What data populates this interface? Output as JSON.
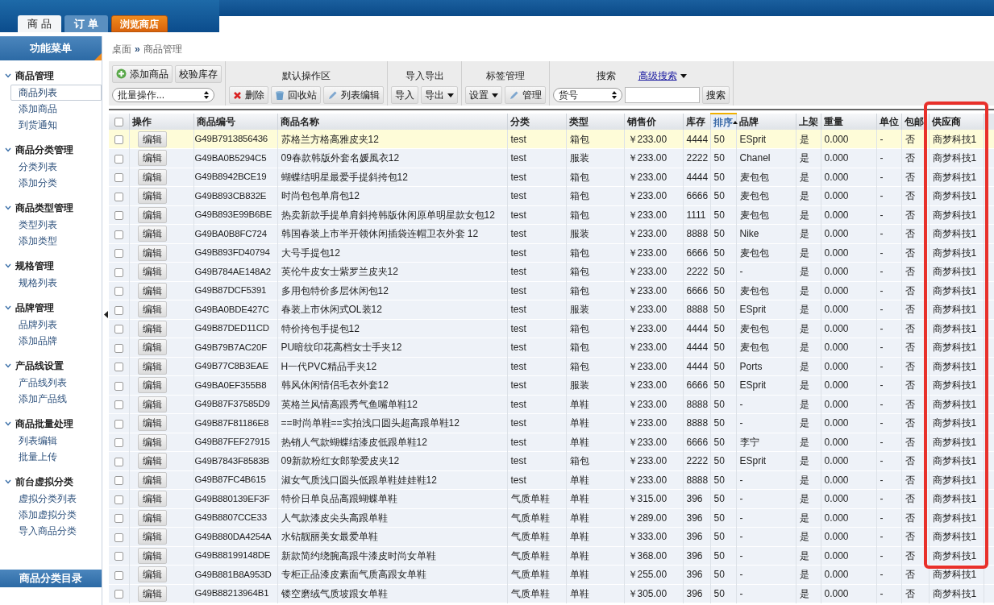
{
  "top_tabs": [
    {
      "label": "商 品",
      "selected": true
    },
    {
      "label": "订 单",
      "selected": false
    }
  ],
  "shop_button": {
    "label": "浏览商店"
  },
  "sidebar": {
    "title": "功能菜单",
    "groups": [
      {
        "title": "商品管理",
        "expanded": true,
        "items": [
          {
            "label": "商品列表",
            "selected": true
          },
          {
            "label": "添加商品",
            "selected": false
          },
          {
            "label": "到货通知",
            "selected": false
          }
        ]
      },
      {
        "title": "商品分类管理",
        "expanded": true,
        "items": [
          {
            "label": "分类列表",
            "selected": false
          },
          {
            "label": "添加分类",
            "selected": false
          }
        ]
      },
      {
        "title": "商品类型管理",
        "expanded": true,
        "items": [
          {
            "label": "类型列表",
            "selected": false
          },
          {
            "label": "添加类型",
            "selected": false
          }
        ]
      },
      {
        "title": "规格管理",
        "expanded": true,
        "items": [
          {
            "label": "规格列表",
            "selected": false
          }
        ]
      },
      {
        "title": "品牌管理",
        "expanded": true,
        "items": [
          {
            "label": "品牌列表",
            "selected": false
          },
          {
            "label": "添加品牌",
            "selected": false
          }
        ]
      },
      {
        "title": "产品线设置",
        "expanded": true,
        "items": [
          {
            "label": "产品线列表",
            "selected": false
          },
          {
            "label": "添加产品线",
            "selected": false
          }
        ]
      },
      {
        "title": "商品批量处理",
        "expanded": true,
        "items": [
          {
            "label": "列表编辑",
            "selected": false
          },
          {
            "label": "批量上传",
            "selected": false
          }
        ]
      },
      {
        "title": "前台虚拟分类",
        "expanded": true,
        "items": [
          {
            "label": "虚拟分类列表",
            "selected": false
          },
          {
            "label": "添加虚拟分类",
            "selected": false
          },
          {
            "label": "导入商品分类",
            "selected": false
          }
        ]
      }
    ],
    "footer": "商品分类目录"
  },
  "breadcrumb": [
    "桌面",
    "»",
    "商品管理"
  ],
  "toolbar": [
    {
      "rows": [
        [
          {
            "kind": "add",
            "label": "添加商品"
          },
          {
            "kind": "button",
            "label": "校验库存"
          }
        ],
        [
          {
            "kind": "select",
            "label": "批量操作..."
          }
        ]
      ]
    },
    {
      "title": "默认操作区",
      "rows": [
        [
          {
            "kind": "delete",
            "label": "删除"
          },
          {
            "kind": "trash",
            "label": "回收站"
          },
          {
            "kind": "edit",
            "label": "列表编辑"
          }
        ]
      ]
    },
    {
      "title": "导入导出",
      "rows": [
        [
          {
            "kind": "button",
            "label": "导入"
          },
          {
            "kind": "dropdown",
            "label": "导出"
          }
        ]
      ]
    },
    {
      "title": "标签管理",
      "rows": [
        [
          {
            "kind": "dropdown",
            "label": "设置"
          },
          {
            "kind": "edit",
            "label": "管理"
          }
        ]
      ]
    },
    {
      "title": "搜索",
      "link": "高级搜索",
      "rows": [
        [
          {
            "kind": "select",
            "label": "货号"
          },
          {
            "kind": "input"
          },
          {
            "kind": "button",
            "label": "搜索"
          }
        ]
      ]
    }
  ],
  "table": {
    "select_all": {
      "checked": false
    },
    "columns": [
      {
        "label": "操作",
        "sorted": false,
        "highlighted": false
      },
      {
        "label": "商品编号",
        "sorted": false,
        "highlighted": false
      },
      {
        "label": "商品名称",
        "sorted": false,
        "highlighted": false
      },
      {
        "label": "分类",
        "sorted": false,
        "highlighted": false
      },
      {
        "label": "类型",
        "sorted": false,
        "highlighted": false
      },
      {
        "label": "销售价",
        "sorted": false,
        "highlighted": false
      },
      {
        "label": "库存",
        "sorted": false,
        "highlighted": false
      },
      {
        "label": "排序",
        "sorted": true,
        "highlighted": false
      },
      {
        "label": "品牌",
        "sorted": false,
        "highlighted": false
      },
      {
        "label": "上架",
        "sorted": false,
        "highlighted": false
      },
      {
        "label": "重量",
        "sorted": false,
        "highlighted": false
      },
      {
        "label": "单位",
        "sorted": false,
        "highlighted": false
      },
      {
        "label": "包邮",
        "sorted": false,
        "highlighted": false
      },
      {
        "label": "供应商",
        "sorted": false,
        "highlighted": true
      }
    ],
    "rows": [
      {
        "selected": true,
        "checked": false,
        "cells": [
          "编辑",
          "G49B7913856436",
          "苏格兰方格高雅皮夹12",
          "test",
          "箱包",
          "￥233.00",
          "4444",
          "50",
          "ESprit",
          "是",
          "0.000",
          "-",
          "否",
          "商梦科技1"
        ]
      },
      {
        "selected": false,
        "checked": false,
        "cells": [
          "编辑",
          "G49BA0B5294C5",
          "09春款韩版外套名媛風衣12",
          "test",
          "服装",
          "￥233.00",
          "2222",
          "50",
          "Chanel",
          "是",
          "0.000",
          "-",
          "否",
          "商梦科技1"
        ]
      },
      {
        "selected": false,
        "checked": false,
        "cells": [
          "编辑",
          "G49B8942BCE19",
          "蝴蝶结明星最爱手提斜挎包12",
          "test",
          "箱包",
          "￥233.00",
          "4444",
          "50",
          "麦包包",
          "是",
          "0.000",
          "-",
          "否",
          "商梦科技1"
        ]
      },
      {
        "selected": false,
        "checked": false,
        "cells": [
          "编辑",
          "G49B893CB832E",
          "时尚包包单肩包12",
          "test",
          "箱包",
          "￥233.00",
          "6666",
          "50",
          "麦包包",
          "是",
          "0.000",
          "-",
          "否",
          "商梦科技1"
        ]
      },
      {
        "selected": false,
        "checked": false,
        "cells": [
          "编辑",
          "G49B893E99B6BE",
          "热卖新款手提单肩斜挎韩版休闲原单明星款女包12",
          "test",
          "箱包",
          "￥233.00",
          "1111",
          "50",
          "麦包包",
          "是",
          "0.000",
          "-",
          "否",
          "商梦科技1"
        ]
      },
      {
        "selected": false,
        "checked": false,
        "cells": [
          "编辑",
          "G49BA0B8FC724",
          "韩国春装上市半开领休闲插袋连帽卫衣外套 12",
          "test",
          "服装",
          "￥233.00",
          "8888",
          "50",
          "Nike",
          "是",
          "0.000",
          "-",
          "否",
          "商梦科技1"
        ]
      },
      {
        "selected": false,
        "checked": false,
        "cells": [
          "编辑",
          "G49B893FD40794",
          "大号手提包12",
          "test",
          "箱包",
          "￥233.00",
          "6666",
          "50",
          "麦包包",
          "是",
          "0.000",
          "-",
          "否",
          "商梦科技1"
        ]
      },
      {
        "selected": false,
        "checked": false,
        "cells": [
          "编辑",
          "G49B784AE148A2",
          "英伦牛皮女士紫罗兰皮夹12",
          "test",
          "箱包",
          "￥233.00",
          "2222",
          "50",
          "-",
          "是",
          "0.000",
          "-",
          "否",
          "商梦科技1"
        ]
      },
      {
        "selected": false,
        "checked": false,
        "cells": [
          "编辑",
          "G49B87DCF5391",
          "多用包特价多层休闲包12",
          "test",
          "箱包",
          "￥233.00",
          "6666",
          "50",
          "麦包包",
          "是",
          "0.000",
          "-",
          "否",
          "商梦科技1"
        ]
      },
      {
        "selected": false,
        "checked": false,
        "cells": [
          "编辑",
          "G49BA0BDE427C",
          "春装上市休闲式OL装12",
          "test",
          "服装",
          "￥233.00",
          "8888",
          "50",
          "ESprit",
          "是",
          "0.000",
          "-",
          "否",
          "商梦科技1"
        ]
      },
      {
        "selected": false,
        "checked": false,
        "cells": [
          "编辑",
          "G49B87DED11CD",
          "特价挎包手提包12",
          "test",
          "箱包",
          "￥233.00",
          "4444",
          "50",
          "麦包包",
          "是",
          "0.000",
          "-",
          "否",
          "商梦科技1"
        ]
      },
      {
        "selected": false,
        "checked": false,
        "cells": [
          "编辑",
          "G49B79B7AC20F",
          "PU暗纹印花高档女士手夹12",
          "test",
          "箱包",
          "￥233.00",
          "4444",
          "50",
          "麦包包",
          "是",
          "0.000",
          "-",
          "否",
          "商梦科技1"
        ]
      },
      {
        "selected": false,
        "checked": false,
        "cells": [
          "编辑",
          "G49B77C8B3EAE",
          "H一代PVC精品手夹12",
          "test",
          "箱包",
          "￥233.00",
          "4444",
          "50",
          "Ports",
          "是",
          "0.000",
          "-",
          "否",
          "商梦科技1"
        ]
      },
      {
        "selected": false,
        "checked": false,
        "cells": [
          "编辑",
          "G49BA0EF355B8",
          "韩风休闲情侣毛衣外套12",
          "test",
          "服装",
          "￥233.00",
          "6666",
          "50",
          "ESprit",
          "是",
          "0.000",
          "-",
          "否",
          "商梦科技1"
        ]
      },
      {
        "selected": false,
        "checked": false,
        "cells": [
          "编辑",
          "G49B87F37585D9",
          "英格兰风情高跟秀气鱼嘴单鞋12",
          "test",
          "单鞋",
          "￥233.00",
          "8888",
          "50",
          "-",
          "是",
          "0.000",
          "-",
          "否",
          "商梦科技1"
        ]
      },
      {
        "selected": false,
        "checked": false,
        "cells": [
          "编辑",
          "G49B87F81186E8",
          "==时尚单鞋==实拍浅口圆头超高跟单鞋12",
          "test",
          "单鞋",
          "￥233.00",
          "8888",
          "50",
          "-",
          "是",
          "0.000",
          "-",
          "否",
          "商梦科技1"
        ]
      },
      {
        "selected": false,
        "checked": false,
        "cells": [
          "编辑",
          "G49B87FEF27915",
          "热销人气款蝴蝶结漆皮低跟单鞋12",
          "test",
          "单鞋",
          "￥233.00",
          "6666",
          "50",
          "李宁",
          "是",
          "0.000",
          "-",
          "否",
          "商梦科技1"
        ]
      },
      {
        "selected": false,
        "checked": false,
        "cells": [
          "编辑",
          "G49B7843F8583B",
          "09新款粉红女郎挚爱皮夹12",
          "test",
          "箱包",
          "￥233.00",
          "2222",
          "50",
          "ESprit",
          "是",
          "0.000",
          "-",
          "否",
          "商梦科技1"
        ]
      },
      {
        "selected": false,
        "checked": false,
        "cells": [
          "编辑",
          "G49B87FC4B615",
          "淑女气质浅口圆头低跟单鞋娃娃鞋12",
          "test",
          "单鞋",
          "￥233.00",
          "8888",
          "50",
          "-",
          "是",
          "0.000",
          "-",
          "否",
          "商梦科技1"
        ]
      },
      {
        "selected": false,
        "checked": false,
        "cells": [
          "编辑",
          "G49B880139EF3F",
          "特价日单良品高跟蝴蝶单鞋",
          "气质单鞋",
          "单鞋",
          "￥315.00",
          "396",
          "50",
          "-",
          "是",
          "0.000",
          "-",
          "否",
          "商梦科技1"
        ]
      },
      {
        "selected": false,
        "checked": false,
        "cells": [
          "编辑",
          "G49B8807CCE33",
          "人气款漆皮尖头高跟单鞋",
          "气质单鞋",
          "单鞋",
          "￥289.00",
          "396",
          "50",
          "-",
          "是",
          "0.000",
          "-",
          "否",
          "商梦科技1"
        ]
      },
      {
        "selected": false,
        "checked": false,
        "cells": [
          "编辑",
          "G49B880DA4254A",
          "水钻靓丽美女最爱单鞋",
          "气质单鞋",
          "单鞋",
          "￥333.00",
          "396",
          "50",
          "-",
          "是",
          "0.000",
          "-",
          "否",
          "商梦科技1"
        ]
      },
      {
        "selected": false,
        "checked": false,
        "cells": [
          "编辑",
          "G49B88199148DE",
          "新款简约绕腕高跟牛漆皮时尚女单鞋",
          "气质单鞋",
          "单鞋",
          "￥368.00",
          "396",
          "50",
          "-",
          "是",
          "0.000",
          "-",
          "否",
          "商梦科技1"
        ]
      },
      {
        "selected": false,
        "checked": false,
        "cells": [
          "编辑",
          "G49B881B8A953D",
          "专柜正品漆皮素面气质高跟女单鞋",
          "气质单鞋",
          "单鞋",
          "￥255.00",
          "396",
          "50",
          "-",
          "是",
          "0.000",
          "-",
          "否",
          "商梦科技1"
        ]
      },
      {
        "selected": false,
        "checked": false,
        "cells": [
          "编辑",
          "G49B88213964B1",
          "镂空磨绒气质坡跟女单鞋",
          "气质单鞋",
          "单鞋",
          "￥305.00",
          "396",
          "50",
          "-",
          "是",
          "0.000",
          "-",
          "否",
          "商梦科技1"
        ]
      }
    ]
  }
}
